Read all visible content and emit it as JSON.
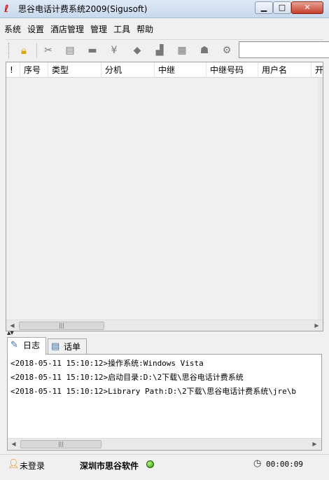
{
  "window": {
    "title": "思谷电话计费系统2009(Sigusoft)"
  },
  "menu": [
    "系统",
    "设置",
    "酒店管理",
    "管理",
    "工具",
    "帮助"
  ],
  "toolbar": {
    "search_value": ""
  },
  "grid": {
    "columns": [
      "!",
      "序号",
      "类型",
      "分机",
      "中继",
      "中继号码",
      "用户名",
      "开"
    ]
  },
  "tabs": [
    "日志",
    "话单"
  ],
  "log_lines": [
    "<2018-05-11 15:10:12>操作系统:Windows Vista",
    "<2018-05-11 15:10:12>启动目录:D:\\2下载\\思谷电话计费系统",
    "<2018-05-11 15:10:12>Library Path:D:\\2下载\\思谷电话计费系统\\jre\\b"
  ],
  "status": {
    "login": "未登录",
    "company": "深圳市思谷软件",
    "timer": "00:00:09"
  },
  "colors": {
    "titlebar": "#dfe9f5",
    "close_button": "#c4402c",
    "online": "#2d9a00"
  }
}
